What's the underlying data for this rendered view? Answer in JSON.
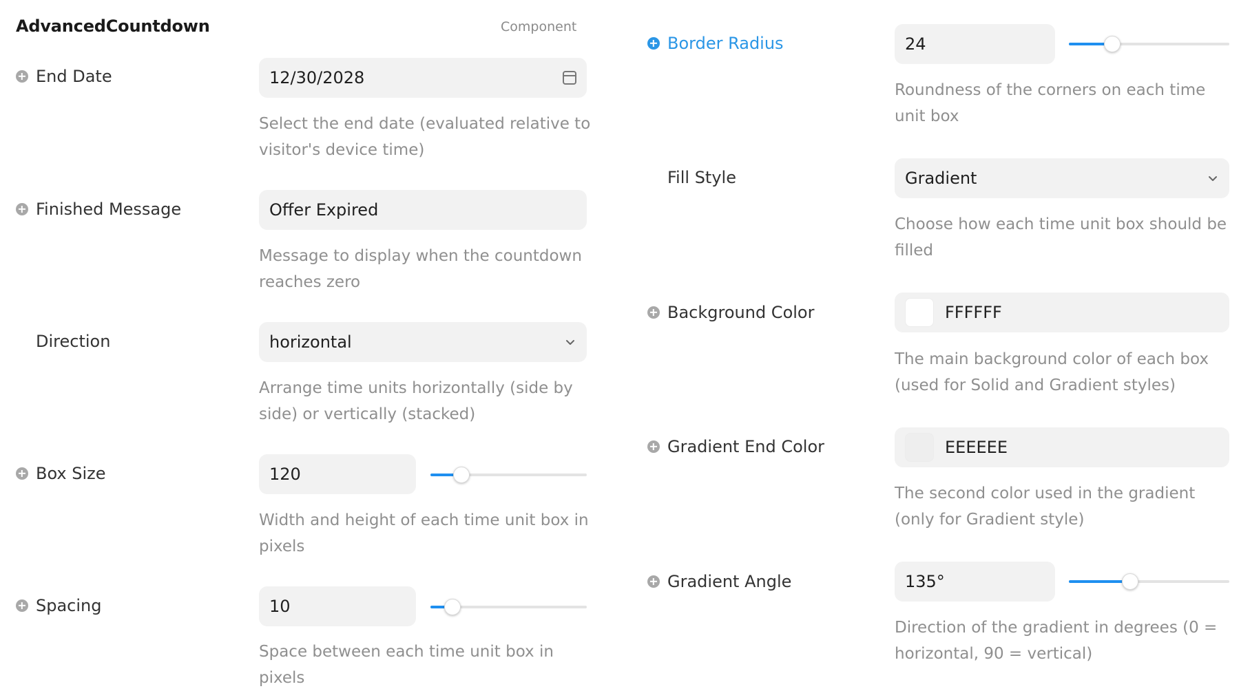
{
  "header": {
    "title": "AdvancedCountdown",
    "tag": "Component"
  },
  "left": {
    "end_date": {
      "label": "End Date",
      "value": "12/30/2028",
      "help_line1": "Select the end date (evaluated relative to",
      "help_line2": "visitor's device time)",
      "icon": "calendar-icon"
    },
    "finished_message": {
      "label": "Finished Message",
      "value": "Offer Expired",
      "help_line1": "Message to display when the countdown",
      "help_line2": "reaches zero"
    },
    "direction": {
      "label": "Direction",
      "value": "horizontal",
      "help_line1": "Arrange time units horizontally (side by",
      "help_line2": "side) or vertically (stacked)",
      "icon": "chevron-down-icon"
    },
    "box_size": {
      "label": "Box Size",
      "value": "120",
      "slider_fraction": 0.2,
      "help_line1": "Width and height of each time unit box in",
      "help_line2": "pixels"
    },
    "spacing": {
      "label": "Spacing",
      "value": "10",
      "slider_fraction": 0.14,
      "help_line1": "Space between each time unit box in",
      "help_line2": "pixels"
    }
  },
  "right": {
    "border_radius": {
      "label": "Border Radius",
      "value": "24",
      "slider_fraction": 0.27,
      "help_line1": "Roundness of the corners on each time",
      "help_line2": "unit box"
    },
    "fill_style": {
      "label": "Fill Style",
      "value": "Gradient",
      "help_line1": "Choose how each time unit box should be",
      "help_line2": "filled",
      "icon": "chevron-down-icon"
    },
    "background_color": {
      "label": "Background Color",
      "value": "FFFFFF",
      "swatch": "#FFFFFF",
      "help_line1": "The main background color of each box",
      "help_line2": "(used for Solid and Gradient styles)"
    },
    "gradient_end_color": {
      "label": "Gradient End Color",
      "value": "EEEEEE",
      "swatch": "#EEEEEE",
      "help_line1": "The second color used in the gradient",
      "help_line2": "(only for Gradient style)"
    },
    "gradient_angle": {
      "label": "Gradient Angle",
      "value": "135°",
      "slider_fraction": 0.38,
      "help_line1": "Direction of the gradient in degrees (0 =",
      "help_line2": "horizontal, 90 = vertical)"
    }
  },
  "colors": {
    "accent": "#1E8FF0",
    "active_label": "#2A96E6",
    "field_bg": "#F2F2F2"
  }
}
